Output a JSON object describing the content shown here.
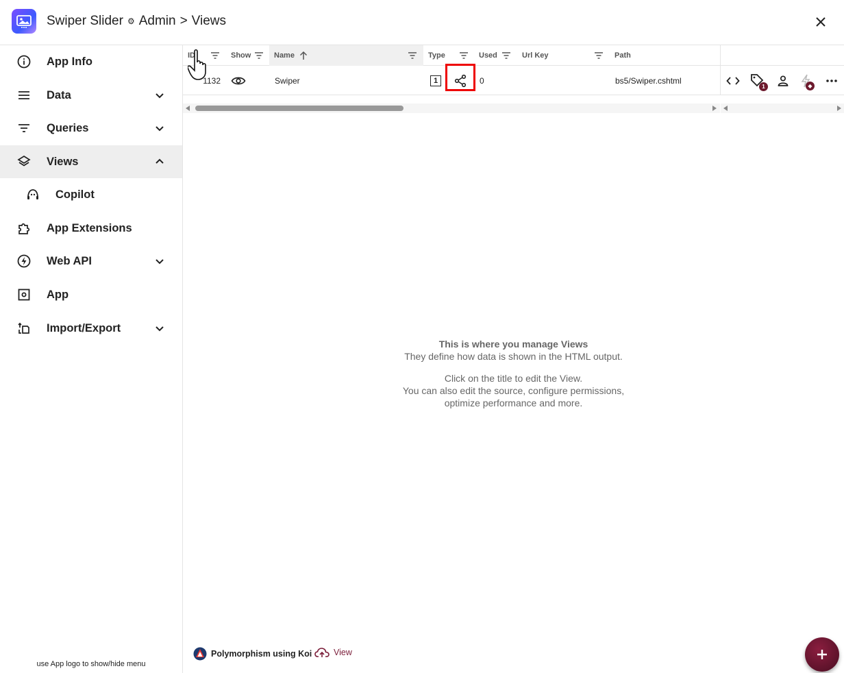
{
  "header": {
    "app_name": "Swiper Slider",
    "section": "Admin",
    "separator": ">",
    "page": "Views"
  },
  "sidebar": {
    "items": [
      {
        "label": "App Info",
        "icon": "info-icon"
      },
      {
        "label": "Data",
        "icon": "menu-lines-icon",
        "expandable": true
      },
      {
        "label": "Queries",
        "icon": "filter-icon",
        "expandable": true
      },
      {
        "label": "Views",
        "icon": "layers-icon",
        "expandable": true,
        "expanded": true,
        "active": true
      },
      {
        "label": "Copilot",
        "icon": "copilot-icon",
        "sub": true
      },
      {
        "label": "App Extensions",
        "icon": "puzzle-icon"
      },
      {
        "label": "Web API",
        "icon": "bolt-icon",
        "expandable": true
      },
      {
        "label": "App",
        "icon": "settings-box-icon"
      },
      {
        "label": "Import/Export",
        "icon": "import-export-icon",
        "expandable": true
      }
    ],
    "hint": "use App logo to show/hide menu"
  },
  "grid": {
    "columns": {
      "id": "ID",
      "show": "Show",
      "name": "Name",
      "type": "Type",
      "used": "Used",
      "url_key": "Url Key",
      "path": "Path"
    },
    "rows": [
      {
        "id": "1132",
        "name": "Swiper",
        "type_badge": "1",
        "used": "0",
        "url_key": "",
        "path": "bs5/Swiper.cshtml",
        "metadata_count": "1"
      }
    ]
  },
  "empty_state": {
    "title": "This is where you manage Views",
    "line1": "They define how data is shown in the HTML output.",
    "line2": "Click on the title to edit the View.",
    "line3": "You can also edit the source, configure permissions,",
    "line4": "optimize performance and more."
  },
  "footer": {
    "polymorphism_label": "Polymorphism using Koi",
    "view_label": "View"
  },
  "colors": {
    "accent": "#7b1e3a",
    "highlight": "#e00000",
    "active_nav": "#eeeeee"
  }
}
